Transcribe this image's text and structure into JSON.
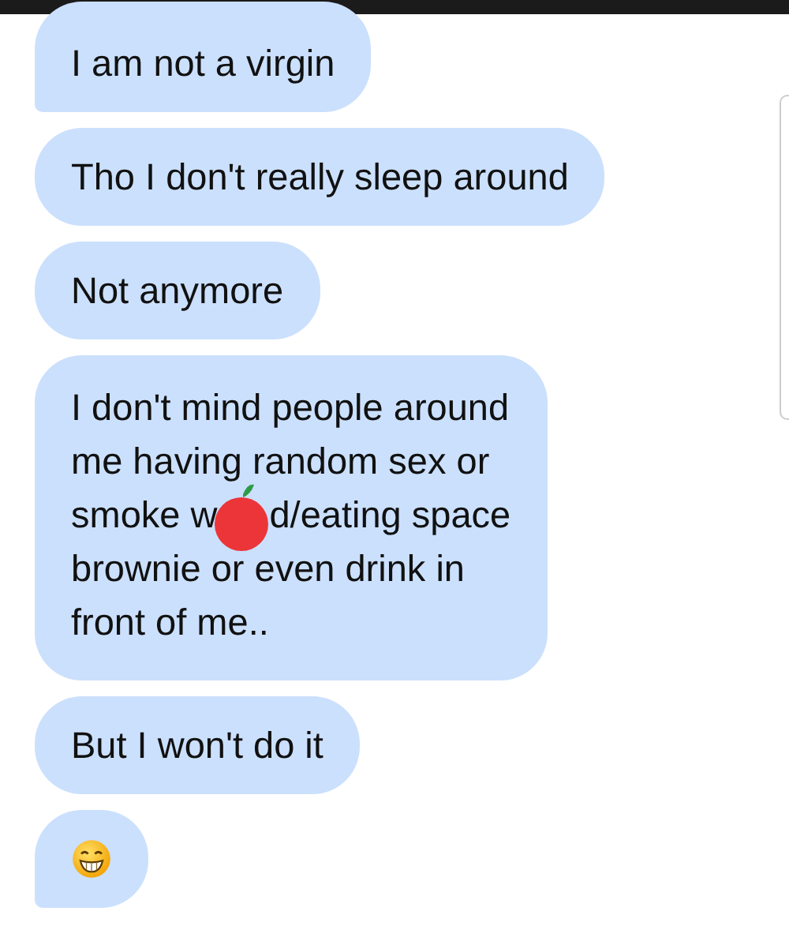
{
  "messages": [
    {
      "kind": "text",
      "text": "I am not a virgin"
    },
    {
      "kind": "text",
      "text": "Tho I don't really sleep around"
    },
    {
      "kind": "text",
      "text": "Not anymore"
    },
    {
      "kind": "sticker_text",
      "lines": [
        {
          "text": "I don't mind people around"
        },
        {
          "text": "me having random sex or"
        },
        {
          "text": "smoke w",
          "after": "d/eating space"
        },
        {
          "text": "brownie or even drink in"
        },
        {
          "text": "front of me.."
        }
      ]
    },
    {
      "kind": "text",
      "text": "But I won't do it"
    },
    {
      "kind": "emoji"
    }
  ]
}
